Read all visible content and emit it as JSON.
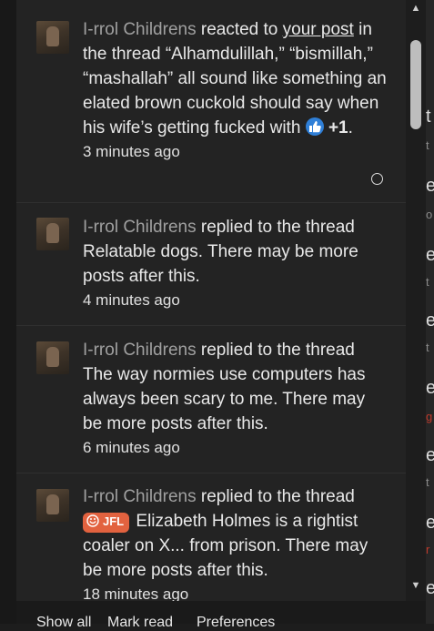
{
  "notifications": [
    {
      "user": "I-rrol Childrens",
      "action": " reacted to ",
      "link": "your post",
      "rest": " in the thread “Alhamdulillah,” “bismillah,” “mashallah” all sound like something an elated brown cuckold should say when his wife’s getting fucked with ",
      "reaction_count": "+1",
      "trailing": ".",
      "time": "3 minutes ago",
      "unread": true
    },
    {
      "user": "I-rrol Childrens",
      "action": " replied to the thread ",
      "rest": "Relatable dogs. There may be more posts after this.",
      "time": "4 minutes ago"
    },
    {
      "user": "I-rrol Childrens",
      "action": " replied to the thread ",
      "rest": "The way normies use computers has always been scary to me. There may be more posts after this.",
      "time": "6 minutes ago"
    },
    {
      "user": "I-rrol Childrens",
      "action": " replied to the thread",
      "prefix": "JFL",
      "rest": " Elizabeth Holmes is a rightist coaler on X... from prison. There may be more posts after this.",
      "time": "18 minutes ago"
    }
  ],
  "footer": {
    "show_all": "Show all",
    "mark_read": "Mark read",
    "preferences": "Preferences"
  },
  "colors": {
    "prefix_bg": "#e2623f",
    "like_bg": "#2f7fd7",
    "username": "#a0a0a0"
  }
}
